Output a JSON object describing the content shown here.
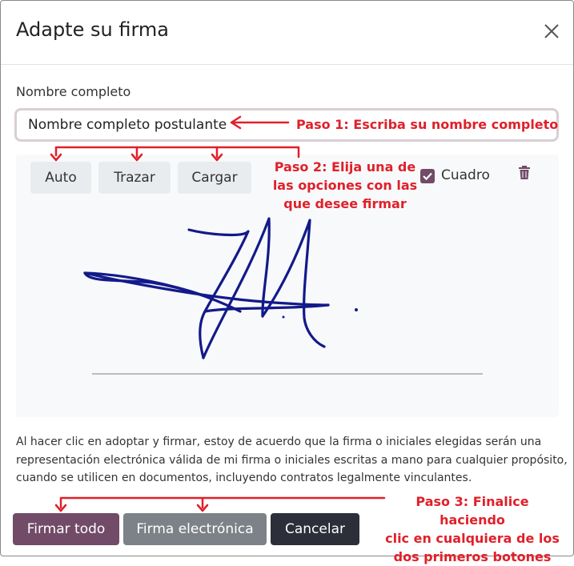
{
  "dialog": {
    "title": "Adapte su firma",
    "close_icon": "close-icon"
  },
  "form": {
    "name_label": "Nombre completo",
    "name_value": "Nombre completo postulante"
  },
  "signature_modes": {
    "auto": "Auto",
    "draw": "Trazar",
    "load": "Cargar",
    "frame_label": "Cuadro",
    "frame_checked": true,
    "trash_icon": "trash-icon"
  },
  "disclaimer": "Al hacer clic en adoptar y firmar, estoy de acuerdo que la firma o iniciales elegidas serán una representación electrónica válida de mi firma o iniciales escritas a mano para cualquier propósito, cuando se utilicen en documentos, incluyendo contratos legalmente vinculantes.",
  "footer": {
    "sign_all": "Firmar todo",
    "electronic_sign": "Firma electrónica",
    "cancel": "Cancelar"
  },
  "annotations": {
    "step1": "Paso 1: Escriba su nombre completo",
    "step2_line1": "Paso 2: Elija una de",
    "step2_line2": "las opciones con las",
    "step2_line3": "que desee firmar",
    "step3_line1": "Paso 3: Finalice haciendo",
    "step3_line2": "clic en cualquiera de los",
    "step3_line3": "dos primeros botones"
  },
  "colors": {
    "primary": "#714b67",
    "secondary": "#7d8288",
    "dark": "#2c2f3a",
    "annotation": "#e0202a",
    "ink": "#121a8a"
  }
}
